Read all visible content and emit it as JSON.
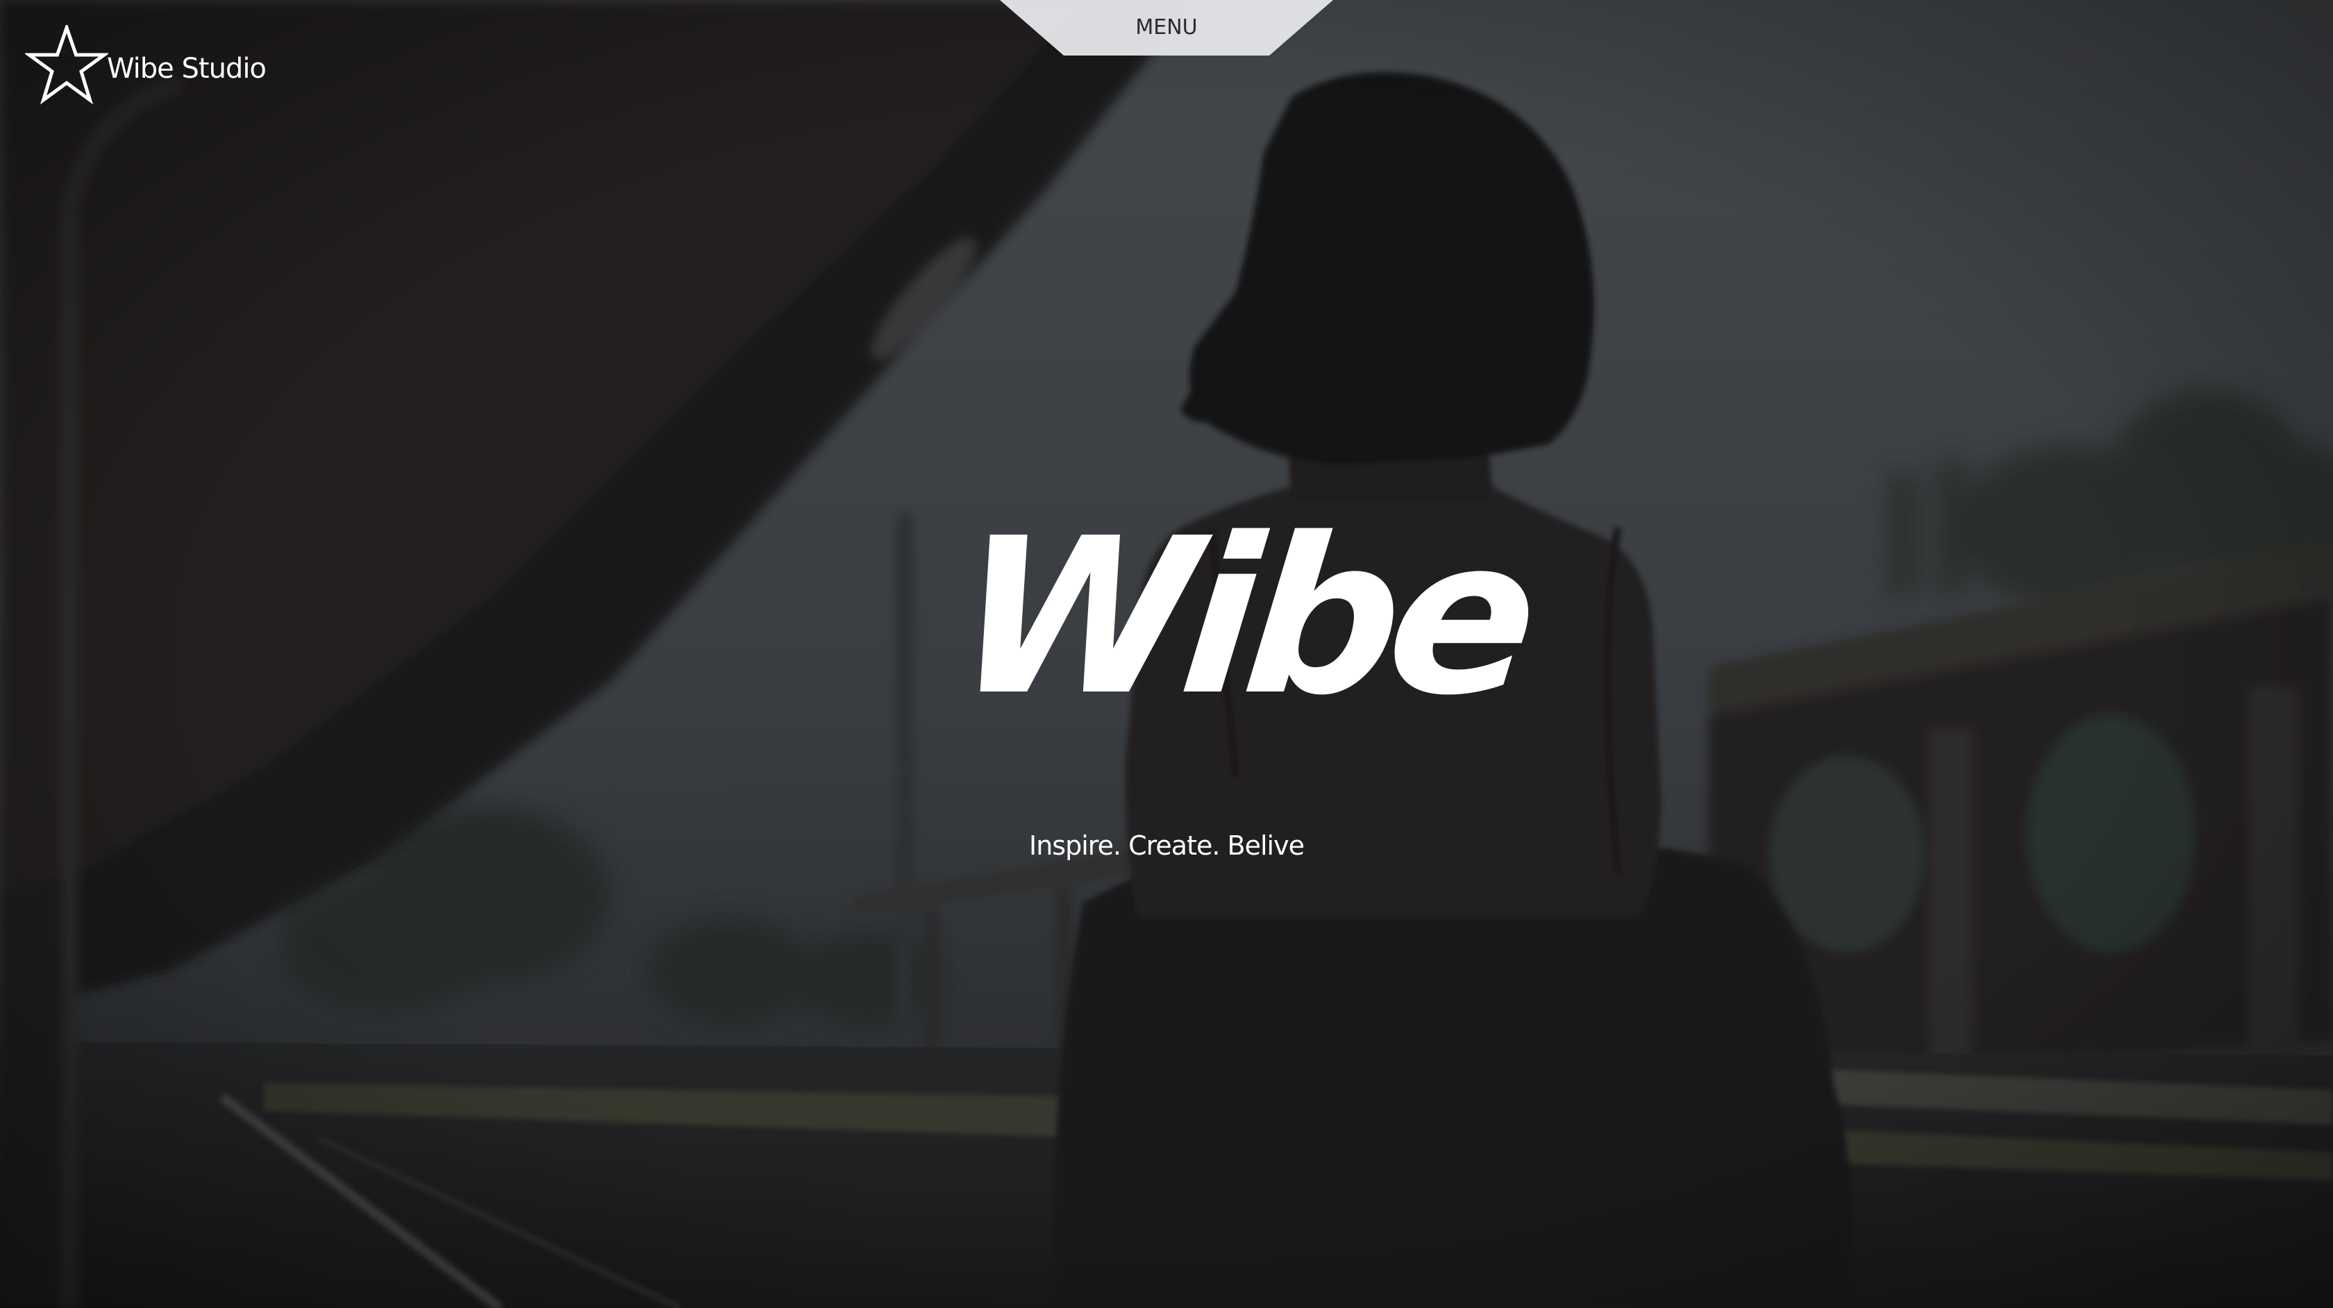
{
  "header": {
    "menu_label": "MENU",
    "logo_text": "Wibe Studio",
    "logo_icon": "star-outline-icon"
  },
  "hero": {
    "title": "Wibe",
    "tagline": "Inspire. Create. Belive"
  },
  "colors": {
    "text": "#ffffff",
    "menu_tab_bg": "#e4e5e8",
    "menu_text": "#2a2a2e",
    "overlay_dark": "#141416"
  }
}
